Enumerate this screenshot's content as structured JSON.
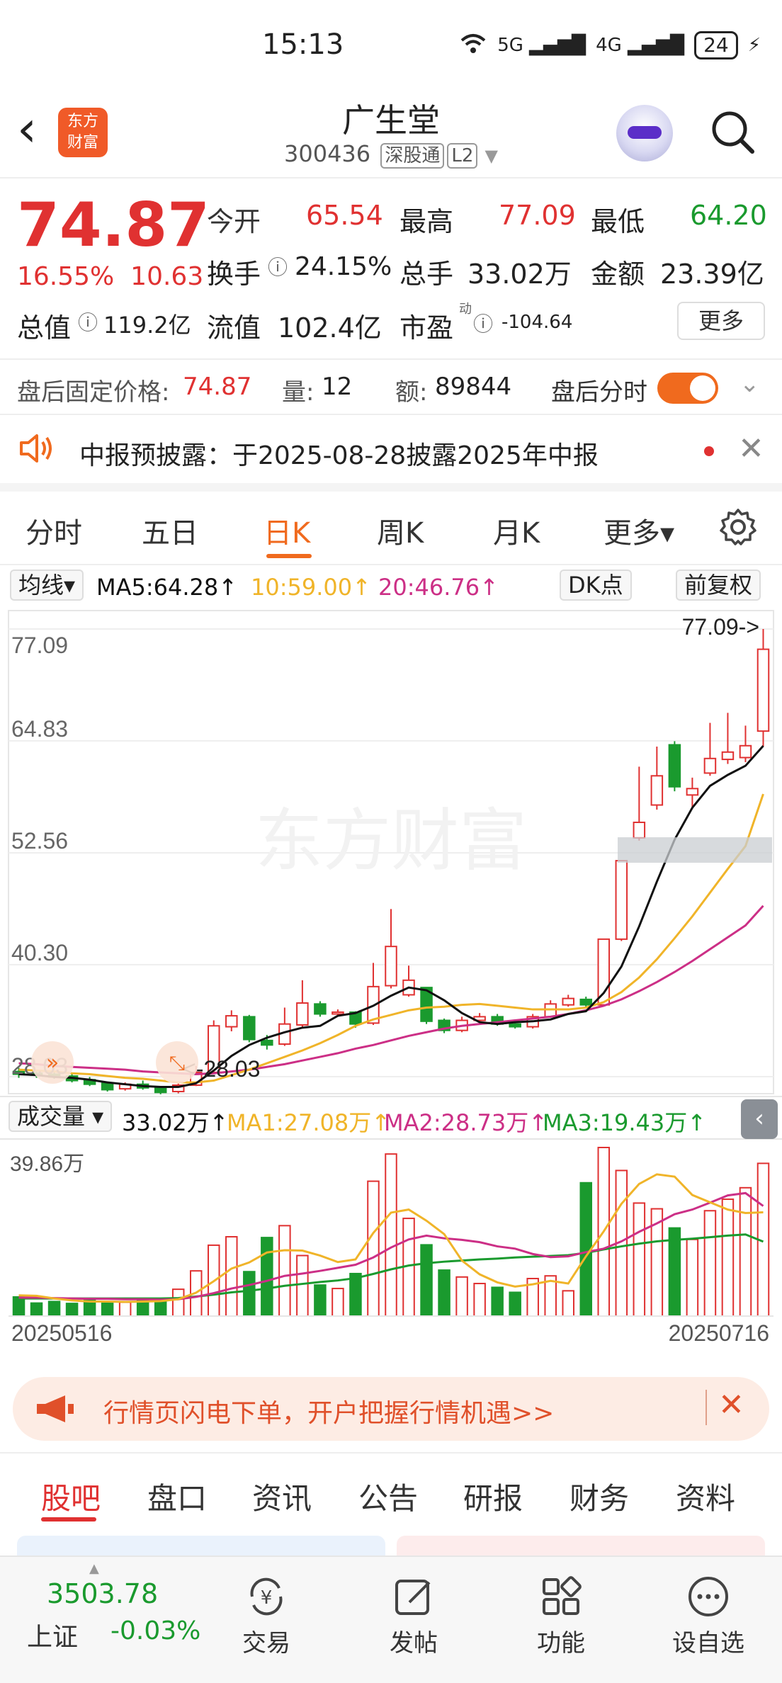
{
  "status_bar": {
    "time": "15:13",
    "signal_5g": "5G",
    "signal_4g": "4G",
    "wifi": "6",
    "battery": "24"
  },
  "header": {
    "logo_text": "东方\n财富",
    "name": "广生堂",
    "code": "300436",
    "tag1": "深股通",
    "tag2": "L2"
  },
  "quote": {
    "price": "74.87",
    "pct": "16.55%",
    "change": "10.63",
    "open_label": "今开",
    "open": "65.54",
    "high_label": "最高",
    "high": "77.09",
    "low_label": "最低",
    "low": "64.20",
    "turnover_label": "换手",
    "turnover": "24.15%",
    "volume_label": "总手",
    "volume": "33.02万",
    "amount_label": "金额",
    "amount": "23.39亿",
    "mktcap_label": "总值",
    "mktcap": "119.2亿",
    "float_label": "流值",
    "float": "102.4亿",
    "pe_label": "市盈",
    "pe_sup": "动",
    "pe": "-104.64",
    "more": "更多"
  },
  "after_hours": {
    "price_label": "盘后固定价格:",
    "price": "74.87",
    "vol_label": "量:",
    "vol": "12",
    "amt_label": "额:",
    "amt": "89844",
    "toggle_label": "盘后分时"
  },
  "notice": {
    "text": "中报预披露：于2025-08-28披露2025年中报"
  },
  "period_tabs": [
    "分时",
    "五日",
    "日K",
    "周K",
    "月K",
    "更多▾"
  ],
  "active_period_index": 2,
  "ma_bar": {
    "select": "均线▾",
    "ma5": "MA5:64.28↑",
    "ma10": "10:59.00↑",
    "ma20": "20:46.76↑",
    "dk": "DK点",
    "adjust": "前复权"
  },
  "chart": {
    "y_ticks": [
      "77.09",
      "64.83",
      "52.56",
      "40.30",
      "28.03"
    ],
    "max_annotation": "77.09->",
    "min_annotation": "<-28.03",
    "watermark": "东方财富",
    "volume_bar": {
      "select": "成交量 ▾",
      "vol": "33.02万↑",
      "ma1": "MA1:27.08万↑",
      "ma2": "MA2:28.73万↑",
      "ma3": "MA3:19.43万↑"
    },
    "vol_max": "39.86万",
    "date_start": "20250516",
    "date_end": "20250716"
  },
  "chart_data": {
    "type": "candlestick",
    "y_range": [
      28.03,
      77.09
    ],
    "candles": [
      {
        "o": 28.6,
        "c": 28.3,
        "h": 29.0,
        "l": 27.9
      },
      {
        "o": 28.4,
        "c": 28.2,
        "h": 28.8,
        "l": 27.9
      },
      {
        "o": 28.3,
        "c": 28.0,
        "h": 28.6,
        "l": 27.8
      },
      {
        "o": 28.1,
        "c": 27.6,
        "h": 28.4,
        "l": 27.4
      },
      {
        "o": 27.7,
        "c": 27.2,
        "h": 28.0,
        "l": 27.0
      },
      {
        "o": 27.3,
        "c": 26.6,
        "h": 27.5,
        "l": 26.4
      },
      {
        "o": 26.7,
        "c": 27.2,
        "h": 27.4,
        "l": 26.5
      },
      {
        "o": 27.2,
        "c": 26.8,
        "h": 27.6,
        "l": 26.6
      },
      {
        "o": 26.8,
        "c": 26.3,
        "h": 27.0,
        "l": 26.1
      },
      {
        "o": 26.4,
        "c": 27.1,
        "h": 27.4,
        "l": 26.2
      },
      {
        "o": 27.1,
        "c": 28.5,
        "h": 29.2,
        "l": 27.0
      },
      {
        "o": 28.5,
        "c": 33.6,
        "h": 34.2,
        "l": 28.4
      },
      {
        "o": 33.5,
        "c": 34.7,
        "h": 35.3,
        "l": 33.0
      },
      {
        "o": 34.6,
        "c": 32.1,
        "h": 34.8,
        "l": 31.8
      },
      {
        "o": 32.0,
        "c": 31.5,
        "h": 32.6,
        "l": 31.0
      },
      {
        "o": 31.6,
        "c": 33.8,
        "h": 35.6,
        "l": 31.4
      },
      {
        "o": 33.7,
        "c": 36.1,
        "h": 38.6,
        "l": 33.5
      },
      {
        "o": 36.0,
        "c": 34.9,
        "h": 36.3,
        "l": 34.6
      },
      {
        "o": 34.9,
        "c": 35.1,
        "h": 35.4,
        "l": 34.7
      },
      {
        "o": 35.1,
        "c": 33.8,
        "h": 35.2,
        "l": 33.4
      },
      {
        "o": 33.9,
        "c": 37.9,
        "h": 40.5,
        "l": 33.7
      },
      {
        "o": 38.0,
        "c": 42.3,
        "h": 46.4,
        "l": 37.7
      },
      {
        "o": 37.0,
        "c": 38.6,
        "h": 40.2,
        "l": 36.8
      },
      {
        "o": 37.8,
        "c": 34.1,
        "h": 37.8,
        "l": 33.8
      },
      {
        "o": 34.2,
        "c": 33.1,
        "h": 34.4,
        "l": 32.8
      },
      {
        "o": 33.1,
        "c": 34.2,
        "h": 34.6,
        "l": 32.9
      },
      {
        "o": 34.2,
        "c": 34.6,
        "h": 35.0,
        "l": 34.0
      },
      {
        "o": 34.6,
        "c": 33.8,
        "h": 34.9,
        "l": 33.6
      },
      {
        "o": 33.8,
        "c": 33.5,
        "h": 34.2,
        "l": 33.3
      },
      {
        "o": 33.5,
        "c": 34.6,
        "h": 34.9,
        "l": 33.3
      },
      {
        "o": 34.6,
        "c": 36.0,
        "h": 36.4,
        "l": 34.5
      },
      {
        "o": 35.9,
        "c": 36.6,
        "h": 37.0,
        "l": 35.7
      },
      {
        "o": 36.5,
        "c": 35.9,
        "h": 36.8,
        "l": 35.6
      },
      {
        "o": 35.9,
        "c": 43.1,
        "h": 43.1,
        "l": 35.8
      },
      {
        "o": 43.1,
        "c": 51.7,
        "h": 51.7,
        "l": 42.9
      },
      {
        "o": 54.2,
        "c": 55.9,
        "h": 62.0,
        "l": 53.9
      },
      {
        "o": 57.8,
        "c": 61.0,
        "h": 64.2,
        "l": 57.3
      },
      {
        "o": 64.4,
        "c": 59.8,
        "h": 64.8,
        "l": 59.3
      },
      {
        "o": 58.9,
        "c": 59.6,
        "h": 60.8,
        "l": 57.5
      },
      {
        "o": 61.3,
        "c": 62.9,
        "h": 66.8,
        "l": 61.0
      },
      {
        "o": 62.8,
        "c": 63.6,
        "h": 67.9,
        "l": 62.3
      },
      {
        "o": 63.0,
        "c": 64.3,
        "h": 66.5,
        "l": 62.5
      },
      {
        "o": 65.9,
        "c": 74.87,
        "h": 77.09,
        "l": 64.2
      }
    ],
    "ma5": [
      28.3,
      28.2,
      28.0,
      27.9,
      27.7,
      27.4,
      27.2,
      27.0,
      26.9,
      26.9,
      27.3,
      28.7,
      30.3,
      31.5,
      32.3,
      32.9,
      33.4,
      33.6,
      34.7,
      35.0,
      35.8,
      36.9,
      37.8,
      37.5,
      36.4,
      35.0,
      34.0,
      33.8,
      34.0,
      34.1,
      34.3,
      34.9,
      35.2,
      37.2,
      40.1,
      44.5,
      49.4,
      54.0,
      57.5,
      59.9,
      61.1,
      62.1,
      64.28
    ],
    "ma10": [
      28.8,
      28.7,
      28.6,
      28.4,
      28.3,
      28.1,
      27.9,
      27.8,
      27.6,
      27.4,
      27.4,
      27.6,
      28.2,
      28.8,
      29.5,
      30.2,
      30.9,
      31.7,
      32.6,
      33.6,
      34.3,
      34.8,
      35.3,
      35.6,
      35.7,
      35.9,
      36.0,
      35.8,
      35.6,
      35.4,
      35.4,
      35.4,
      35.6,
      36.2,
      37.3,
      38.9,
      40.9,
      43.2,
      45.6,
      48.2,
      50.8,
      53.3,
      59.0
    ],
    "ma20": [
      29.5,
      29.4,
      29.2,
      29.1,
      29.0,
      28.9,
      28.8,
      28.6,
      28.5,
      28.4,
      28.3,
      28.4,
      28.6,
      28.8,
      29.1,
      29.4,
      29.8,
      30.2,
      30.6,
      31.1,
      31.5,
      32.0,
      32.5,
      32.9,
      33.3,
      33.6,
      33.8,
      34.0,
      34.2,
      34.4,
      34.6,
      34.9,
      35.3,
      35.8,
      36.5,
      37.4,
      38.4,
      39.5,
      40.7,
      42.0,
      43.3,
      44.6,
      46.76
    ],
    "volumes": [
      5.0,
      3.4,
      3.8,
      3.3,
      4.3,
      3.4,
      3.6,
      4.3,
      3.8,
      7.0,
      11.8,
      18.5,
      20.7,
      11.6,
      20.5,
      23.6,
      15.8,
      8.1,
      7.2,
      11.1,
      35.2,
      42.3,
      25.5,
      18.6,
      12.0,
      10.2,
      8.5,
      7.5,
      6.2,
      9.8,
      10.5,
      6.6,
      34.8,
      44.0,
      38.0,
      29.5,
      28.0,
      23.0,
      20.0,
      27.5,
      30.5,
      33.5,
      39.86
    ],
    "vol_ma1": [
      5.4,
      5.3,
      4.6,
      4.1,
      3.8,
      3.8,
      3.7,
      3.8,
      3.9,
      4.4,
      6.1,
      9.1,
      12.4,
      14.0,
      16.6,
      17.2,
      17.1,
      15.8,
      14.1,
      14.8,
      21.7,
      27.0,
      27.8,
      24.9,
      21.4,
      14.5,
      10.9,
      8.8,
      7.7,
      8.3,
      9.2,
      8.5,
      15.6,
      22.1,
      29.3,
      34.5,
      37.0,
      36.4,
      31.6,
      29.7,
      27.8,
      26.9,
      27.08
    ],
    "vol_ma2": [
      4.8,
      4.8,
      4.7,
      4.6,
      4.5,
      4.5,
      4.4,
      4.4,
      4.3,
      4.4,
      5.0,
      6.0,
      7.2,
      8.1,
      9.2,
      10.5,
      11.1,
      11.8,
      12.6,
      13.4,
      15.3,
      17.9,
      20.0,
      21.0,
      20.3,
      19.9,
      19.3,
      18.2,
      17.6,
      16.2,
      15.4,
      15.6,
      16.7,
      17.6,
      19.5,
      22.0,
      24.2,
      26.6,
      27.8,
      29.6,
      31.5,
      32.1,
      28.73
    ],
    "vol_ma3": [
      4.6,
      4.6,
      4.6,
      4.6,
      4.6,
      4.6,
      4.6,
      4.6,
      4.6,
      4.7,
      5.1,
      5.6,
      6.2,
      6.6,
      7.2,
      7.9,
      8.4,
      8.9,
      9.3,
      9.9,
      11.0,
      12.2,
      13.2,
      13.8,
      14.2,
      14.5,
      14.8,
      15.0,
      15.3,
      15.5,
      15.7,
      15.9,
      16.5,
      17.4,
      18.2,
      18.9,
      19.5,
      19.9,
      20.2,
      20.6,
      21.0,
      21.3,
      19.43
    ]
  },
  "banner": {
    "text": "行情页闪电下单，开户把握行情机遇>>"
  },
  "bottom_tabs": [
    "股吧",
    "盘口",
    "资讯",
    "公告",
    "研报",
    "财务",
    "资料"
  ],
  "navbar": {
    "index_value": "3503.78",
    "index_name": "上证",
    "index_pct": "-0.03%",
    "trade": "交易",
    "post": "发帖",
    "func": "功能",
    "watch": "设自选"
  },
  "colors": {
    "up": "#e03131",
    "down": "#1a9a2e",
    "accent": "#f06a1e",
    "ma5": "#111111",
    "ma10": "#f0b429",
    "ma20": "#cc2f86"
  }
}
